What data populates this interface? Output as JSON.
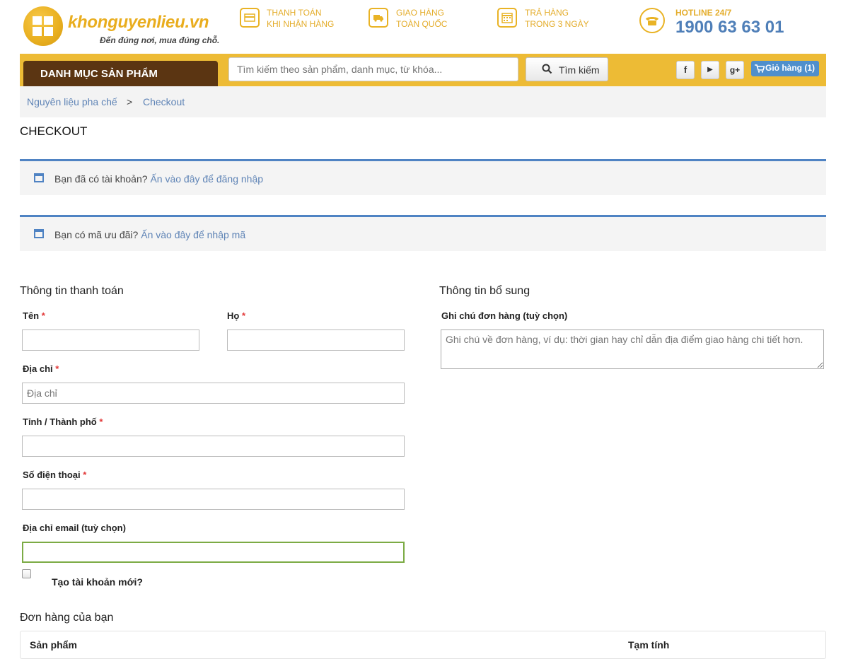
{
  "brand": {
    "name": "khonguyenlieu.vn",
    "tagline": "Đến đúng nơi, mua đúng chỗ."
  },
  "features": [
    {
      "line1": "THANH TOÁN",
      "line2": "KHI NHẬN HÀNG",
      "icon": "credit-card-icon"
    },
    {
      "line1": "GIAO HÀNG",
      "line2": "TOÀN QUỐC",
      "icon": "truck-icon"
    },
    {
      "line1": "TRẢ HÀNG",
      "line2": "TRONG 3 NGÀY",
      "icon": "calendar-icon"
    }
  ],
  "hotline": {
    "label": "HOTLINE 24/7",
    "number": "1900 63 63 01",
    "icon": "phone-icon"
  },
  "nav": {
    "category_label": "DANH MỤC SẢN PHẨM",
    "search_placeholder": "Tìm kiếm theo sản phẩm, danh mục, từ khóa...",
    "search_button": "Tìm kiếm",
    "social": {
      "facebook": "f",
      "youtube": "▶",
      "google": "g+"
    },
    "cart_label": "Giỏ hàng (1)"
  },
  "breadcrumb": {
    "home": "Nguyên liệu pha chế",
    "separator": ">",
    "current": "Checkout"
  },
  "page_title": "CHECKOUT",
  "notices": {
    "login": {
      "text": "Bạn đã có tài khoản?",
      "link": "Ấn vào đây để đăng nhập"
    },
    "coupon": {
      "text": "Bạn có mã ưu đãi?",
      "link": "Ấn vào đây để nhập mã"
    }
  },
  "billing": {
    "title": "Thông tin thanh toán",
    "first_name_label": "Tên",
    "last_name_label": "Họ",
    "address_label": "Địa chỉ",
    "address_placeholder": "Địa chỉ",
    "city_label": "Tỉnh / Thành phố",
    "phone_label": "Số điện thoại",
    "email_label": "Địa chỉ email (tuỳ chọn)",
    "create_account_label": "Tạo tài khoản mới?",
    "required_mark": "*"
  },
  "additional": {
    "title": "Thông tin bổ sung",
    "notes_label": "Ghi chú đơn hàng (tuỳ chọn)",
    "notes_placeholder": "Ghi chú về đơn hàng, ví dụ: thời gian hay chỉ dẫn địa điểm giao hàng chi tiết hơn."
  },
  "order": {
    "title": "Đơn hàng của bạn",
    "col_product": "Sản phẩm",
    "col_subtotal": "Tạm tính"
  },
  "colors": {
    "accent": "#edbb35",
    "brown": "#5b3512",
    "link": "#5f84b6",
    "blue_border": "#4f83c3"
  }
}
